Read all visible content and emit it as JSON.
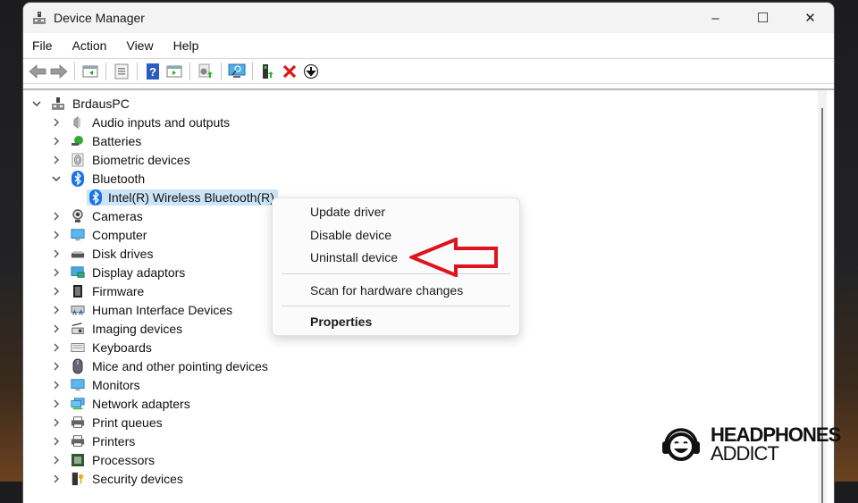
{
  "window": {
    "title": "Device Manager",
    "controls": {
      "minimize": "–",
      "maximize": "☐",
      "close": "✕"
    }
  },
  "menu": [
    "File",
    "Action",
    "View",
    "Help"
  ],
  "toolbar": {
    "buttons": [
      "back-arrow",
      "forward-arrow",
      "show-hide-console-tree",
      "properties",
      "help",
      "show-action-pane",
      "update-driver",
      "scan-hardware",
      "add-legacy-hardware",
      "uninstall-device",
      "enable-device"
    ]
  },
  "tree": {
    "root": "BrdausPC",
    "categories": [
      {
        "label": "Audio inputs and outputs",
        "icon": "speaker-icon",
        "expanded": false
      },
      {
        "label": "Batteries",
        "icon": "battery-icon",
        "expanded": false
      },
      {
        "label": "Biometric devices",
        "icon": "fingerprint-icon",
        "expanded": false
      },
      {
        "label": "Bluetooth",
        "icon": "bluetooth-icon",
        "expanded": true
      },
      {
        "label": "Cameras",
        "icon": "camera-icon",
        "expanded": false
      },
      {
        "label": "Computer",
        "icon": "computer-icon",
        "expanded": false
      },
      {
        "label": "Disk drives",
        "icon": "disk-drive-icon",
        "expanded": false
      },
      {
        "label": "Display adaptors",
        "icon": "display-adapter-icon",
        "expanded": false
      },
      {
        "label": "Firmware",
        "icon": "firmware-chip-icon",
        "expanded": false
      },
      {
        "label": "Human Interface Devices",
        "icon": "hid-icon",
        "expanded": false
      },
      {
        "label": "Imaging devices",
        "icon": "imaging-device-icon",
        "expanded": false
      },
      {
        "label": "Keyboards",
        "icon": "keyboard-icon",
        "expanded": false
      },
      {
        "label": "Mice and other pointing devices",
        "icon": "mouse-icon",
        "expanded": false
      },
      {
        "label": "Monitors",
        "icon": "monitor-icon",
        "expanded": false
      },
      {
        "label": "Network adapters",
        "icon": "network-adapter-icon",
        "expanded": false
      },
      {
        "label": "Print queues",
        "icon": "printer-icon",
        "expanded": false
      },
      {
        "label": "Printers",
        "icon": "printer-icon",
        "expanded": false
      },
      {
        "label": "Processors",
        "icon": "processor-icon",
        "expanded": false
      },
      {
        "label": "Security devices",
        "icon": "security-device-icon",
        "expanded": false
      }
    ],
    "bluetooth_child": "Intel(R) Wireless Bluetooth(R)"
  },
  "context_menu": {
    "items": [
      "Update driver",
      "Disable device",
      "Uninstall device",
      "Scan for hardware changes",
      "Properties"
    ],
    "highlighted_target": "Uninstall device"
  },
  "annotation": {
    "arrow_color": "#e0141e"
  },
  "watermark": {
    "line1": "HEADPHONES",
    "line2": "ADDICT"
  }
}
